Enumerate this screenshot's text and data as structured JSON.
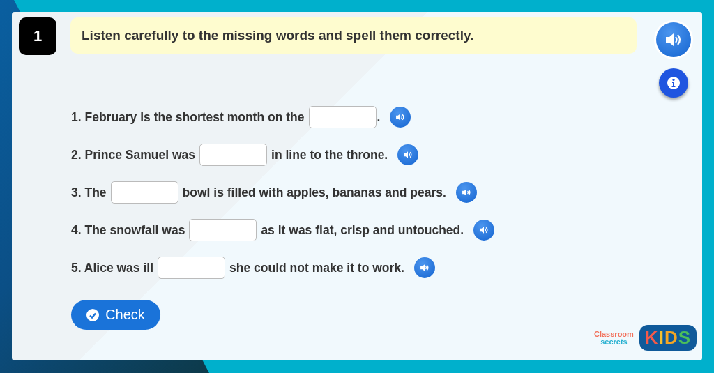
{
  "question": {
    "number": "1",
    "instruction": "Listen carefully to the missing words and spell them correctly."
  },
  "sentences": [
    {
      "before": "1. February is the shortest month on the",
      "after": "."
    },
    {
      "before": "2. Prince Samuel was",
      "after": "in line to the throne."
    },
    {
      "before": "3. The",
      "after": "bowl is filled with apples, bananas and pears."
    },
    {
      "before": "4. The snowfall was",
      "after": "as it was flat, crisp and untouched."
    },
    {
      "before": "5. Alice was ill",
      "after": "she could not make it to work."
    }
  ],
  "check_button": {
    "label": "Check"
  },
  "logo": {
    "line_1": "Classroom",
    "line_2": "secrets",
    "badge": "KIDS"
  }
}
